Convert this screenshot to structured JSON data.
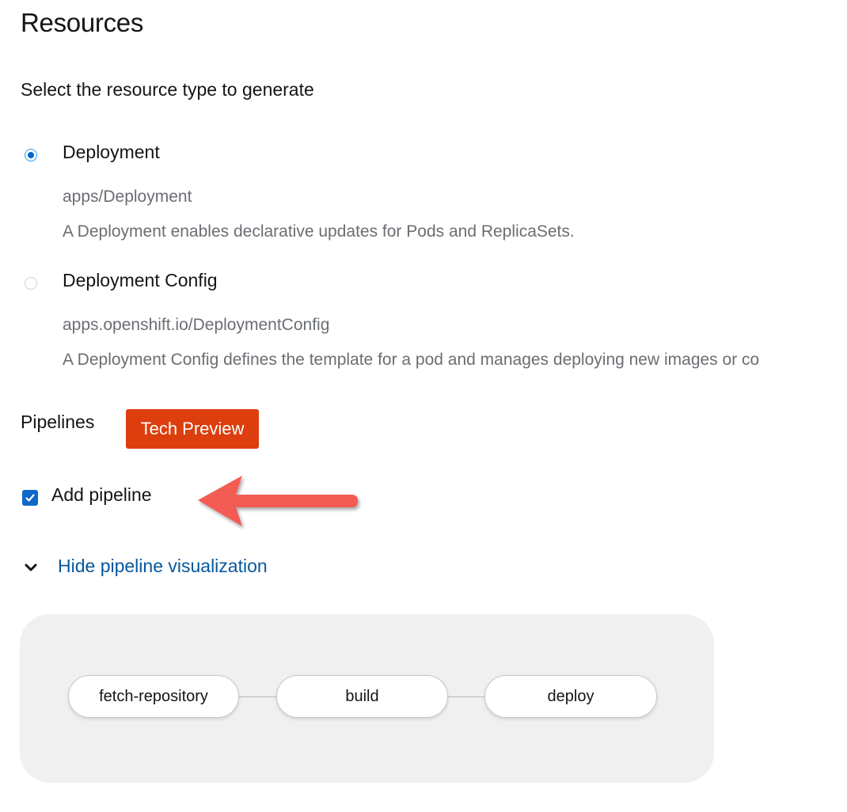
{
  "page": {
    "title": "Resources",
    "subtitle": "Select the resource type to generate"
  },
  "resource_options": [
    {
      "label": "Deployment",
      "api": "apps/Deployment",
      "description": "A Deployment enables declarative updates for Pods and ReplicaSets.",
      "selected": true
    },
    {
      "label": "Deployment Config",
      "api": "apps.openshift.io/DeploymentConfig",
      "description": "A Deployment Config defines the template for a pod and manages deploying new images or co",
      "selected": false
    }
  ],
  "pipelines": {
    "label": "Pipelines",
    "badge": "Tech Preview",
    "add_pipeline_label": "Add pipeline",
    "add_pipeline_checked": true,
    "toggle_label": "Hide pipeline visualization",
    "tasks": [
      "fetch-repository",
      "build",
      "deploy"
    ]
  },
  "colors": {
    "badge_bg": "#dd3e0e",
    "link": "#06579d",
    "radio_selected": "#0066cc",
    "checkbox": "#0f68c9",
    "annotation_arrow": "#f25c54",
    "viz_bg": "#f0f0f0"
  },
  "icons": {
    "chevron": "chevron-down-icon",
    "annotation": "arrow-left-icon"
  }
}
